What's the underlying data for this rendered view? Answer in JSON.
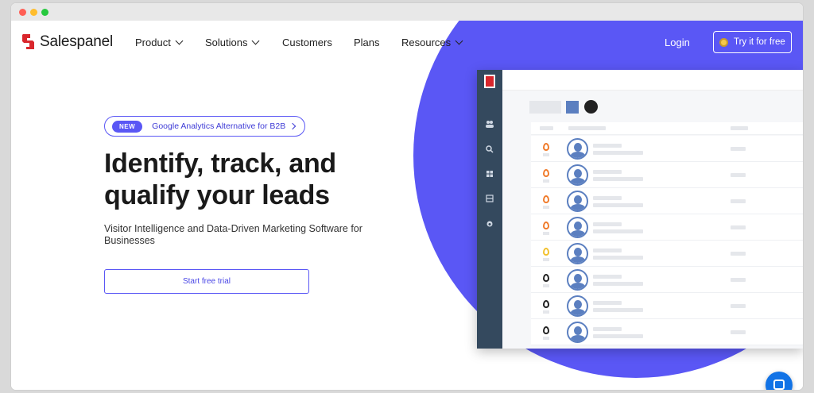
{
  "window": {
    "dot_colors": [
      "#ff5f56",
      "#ffbd2e",
      "#27c93f"
    ]
  },
  "brand": {
    "name": "Salespanel",
    "accent": "#5a57f5",
    "logo_red": "#d9262c"
  },
  "nav": {
    "items": [
      {
        "label": "Product",
        "dropdown": true
      },
      {
        "label": "Solutions",
        "dropdown": true
      },
      {
        "label": "Customers",
        "dropdown": false
      },
      {
        "label": "Plans",
        "dropdown": false
      },
      {
        "label": "Resources",
        "dropdown": true
      }
    ],
    "login": "Login",
    "try_button": "Try it for free"
  },
  "hero": {
    "pill_badge": "NEW",
    "pill_text": "Google Analytics Alternative for B2B",
    "headline": "Identify, track, and qualify your leads",
    "subheadline": "Visitor Intelligence and Data-Driven Marketing Software for Businesses",
    "cta": "Start free trial"
  },
  "app_preview": {
    "sidebar_icons": [
      "users-icon",
      "search-icon",
      "grid-icon",
      "list-icon",
      "flame-icon"
    ],
    "rows": [
      {
        "flame_color": "#f07b2b"
      },
      {
        "flame_color": "#f07b2b"
      },
      {
        "flame_color": "#f07b2b"
      },
      {
        "flame_color": "#f07b2b"
      },
      {
        "flame_color": "#f2c12e"
      },
      {
        "flame_color": "#222222"
      },
      {
        "flame_color": "#222222"
      },
      {
        "flame_color": "#222222"
      }
    ]
  },
  "chat": {
    "icon": "chat-icon"
  }
}
